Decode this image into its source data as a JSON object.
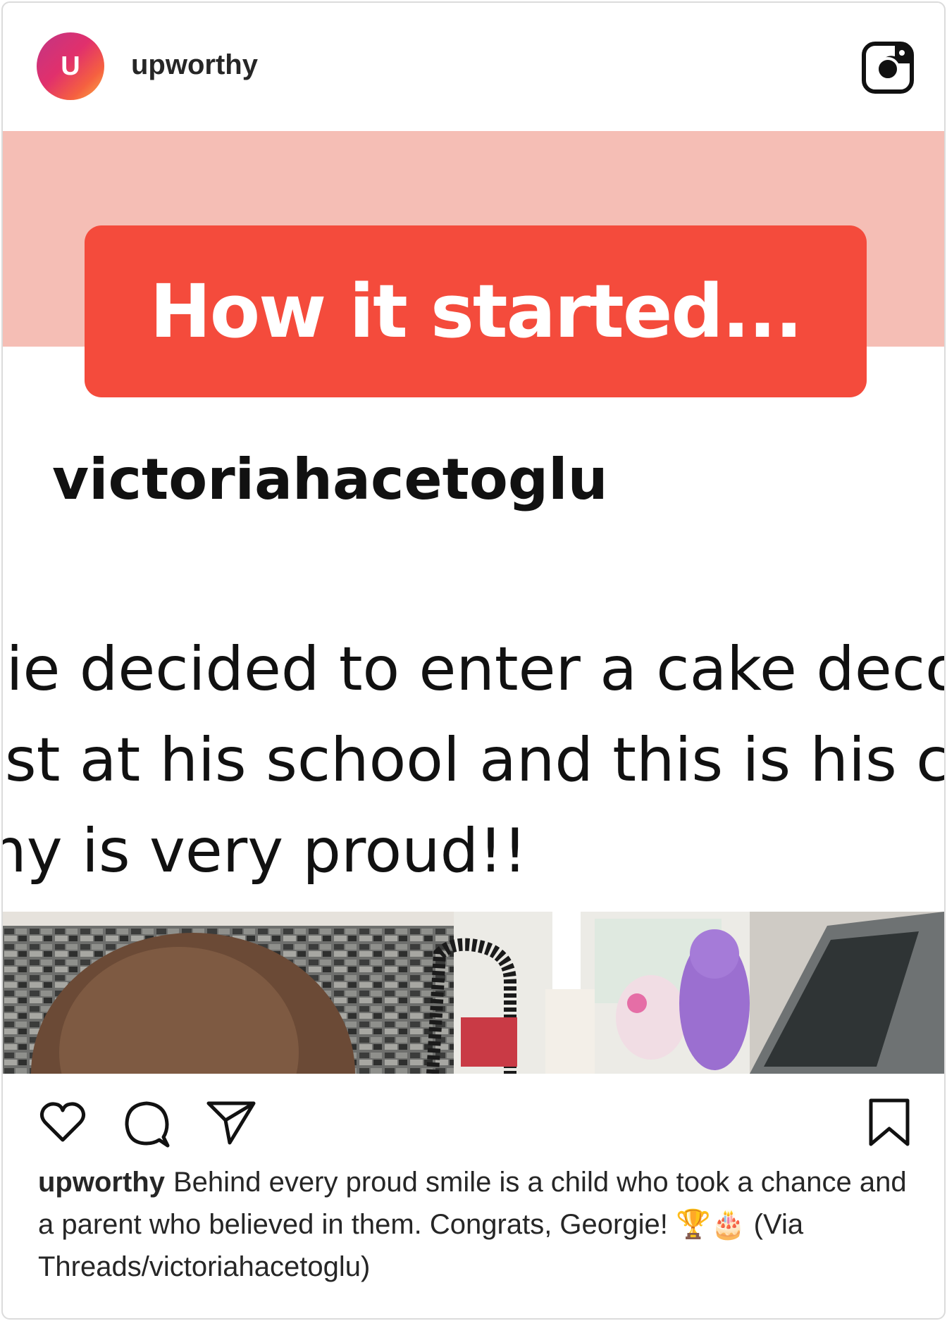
{
  "header": {
    "avatar_letter": "U",
    "username": "upworthy",
    "logo_icon": "instagram-logo-icon"
  },
  "post": {
    "banner_text": "How it started...",
    "thread_username": "victoriahacetoglu",
    "quote_lines": [
      "gie decided to enter a cake deco",
      "est at his school and this is his ca",
      "my is very proud!!"
    ],
    "colors": {
      "pink_band": "#f5beb5",
      "banner": "#f44b3c"
    }
  },
  "actions": {
    "like_icon": "heart-icon",
    "comment_icon": "comment-icon",
    "share_icon": "send-icon",
    "save_icon": "bookmark-icon"
  },
  "caption": {
    "username": "upworthy",
    "text": "Behind every proud smile is a child who took a chance and a parent who believed in them. Congrats, Georgie! 🏆🎂 (Via Threads/victoriahacetoglu)"
  }
}
